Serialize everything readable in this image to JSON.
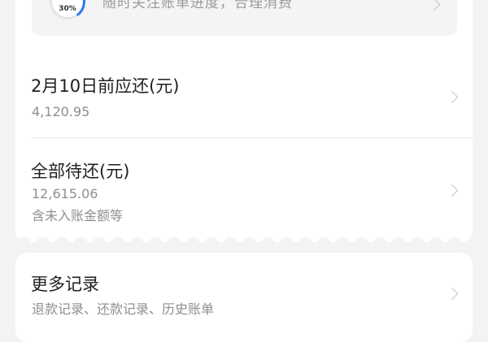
{
  "progress": {
    "percent_label": "30%",
    "percent": 30,
    "message": "随时关注账单进度，合理消费"
  },
  "due": {
    "title": "2月10日前应还(元)",
    "amount": "4,120.95"
  },
  "total": {
    "title": "全部待还(元)",
    "amount": "12,615.06",
    "note": "含未入账金额等"
  },
  "records": {
    "title": "更多记录",
    "subtitle": "退款记录、还款记录、历史账单"
  },
  "colors": {
    "accent": "#2f7bf2",
    "background": "#f3f3f3",
    "card": "#ffffff"
  },
  "icons": {
    "progress": "progress-ring-icon",
    "chevron": "chevron-right-icon"
  }
}
